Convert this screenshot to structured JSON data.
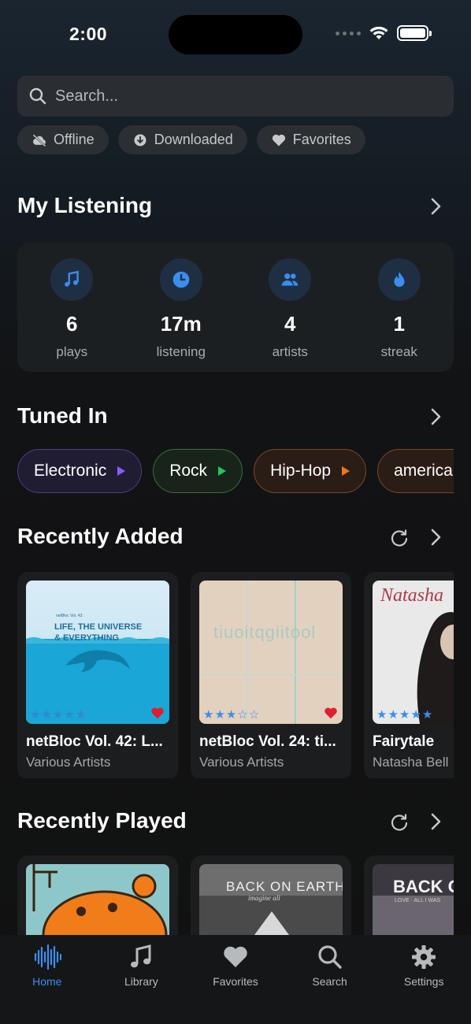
{
  "status_bar": {
    "time": "2:00"
  },
  "search": {
    "placeholder": "Search..."
  },
  "filters": [
    {
      "label": "Offline",
      "icon": "cloud-off-icon"
    },
    {
      "label": "Downloaded",
      "icon": "download-circle-icon"
    },
    {
      "label": "Favorites",
      "icon": "heart-icon"
    }
  ],
  "my_listening": {
    "title": "My Listening",
    "stats": [
      {
        "value": "6",
        "label": "plays",
        "icon": "music-note-icon"
      },
      {
        "value": "17m",
        "label": "listening",
        "icon": "clock-icon"
      },
      {
        "value": "4",
        "label": "artists",
        "icon": "people-icon"
      },
      {
        "value": "1",
        "label": "streak",
        "icon": "flame-icon"
      }
    ]
  },
  "tuned_in": {
    "title": "Tuned In",
    "genres": [
      {
        "label": "Electronic",
        "color": "#8b5cf6",
        "bg": "#201d33",
        "border": "#4a3f80"
      },
      {
        "label": "Rock",
        "color": "#22c55e",
        "bg": "#18241a",
        "border": "#3b6b3f"
      },
      {
        "label": "Hip-Hop",
        "color": "#f97316",
        "bg": "#2a1d15",
        "border": "#7a4727"
      },
      {
        "label": "americana",
        "color": "#f97316",
        "bg": "#2a1d15",
        "border": "#7a4727"
      }
    ]
  },
  "recently_added": {
    "title": "Recently Added",
    "items": [
      {
        "title": "netBloc Vol. 42: L...",
        "artist": "Various Artists",
        "rating": 0,
        "favorite": true,
        "cover_text": "LIFE, THE UNIVERSE & EVERYTHING",
        "cover_small": "netBloc Vol. 42:"
      },
      {
        "title": "netBloc Vol. 24: ti...",
        "artist": "Various Artists",
        "rating": 3,
        "favorite": true,
        "cover_text": "tiuoitqgiitool"
      },
      {
        "title": "Fairytale",
        "artist": "Natasha Bell",
        "rating": 5,
        "favorite": false,
        "cover_text": "Natasha"
      }
    ]
  },
  "recently_played": {
    "title": "Recently Played",
    "items": [
      {
        "cover_text": ""
      },
      {
        "cover_text": "BACK ON EARTH",
        "cover_sub": "imagine all"
      },
      {
        "cover_text": "BACK ON",
        "cover_sub": "LOVE · ALL I WAS"
      }
    ]
  },
  "tabs": [
    {
      "label": "Home",
      "icon": "waveform-icon",
      "active": true
    },
    {
      "label": "Library",
      "icon": "music-note-icon",
      "active": false
    },
    {
      "label": "Favorites",
      "icon": "heart-icon",
      "active": false
    },
    {
      "label": "Search",
      "icon": "search-icon",
      "active": false
    },
    {
      "label": "Settings",
      "icon": "gear-icon",
      "active": false
    }
  ],
  "colors": {
    "accent": "#3b8ef0",
    "heart": "#e11d2e",
    "star": "#3b8ef0"
  }
}
